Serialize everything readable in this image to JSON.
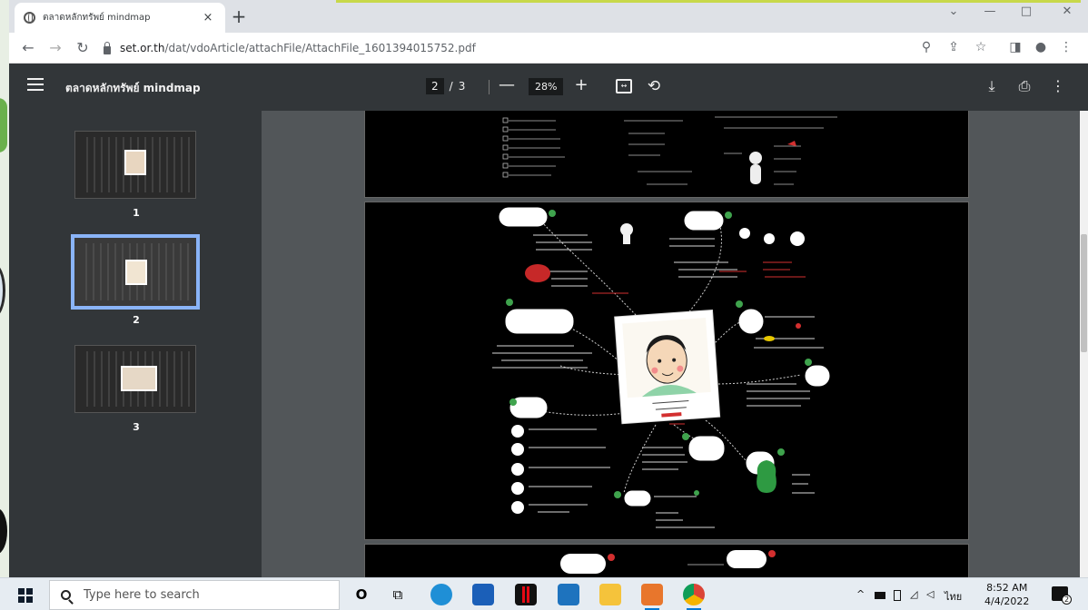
{
  "browser": {
    "tab_title": "ตลาดหลักทรัพย์ mindmap",
    "tab_close": "×",
    "new_tab": "+",
    "win_minimize": "—",
    "win_maximize": "□",
    "win_close": "✕",
    "tab_search": "⌄",
    "url_host": "set.or.th",
    "url_path": "/dat/vdoArticle/attachFile/AttachFile_1601394015752.pdf"
  },
  "pdf": {
    "title": "ตลาดหลักทรัพย์ mindmap",
    "current_page": "2",
    "page_sep": "/",
    "total_pages": "3",
    "zoom_minus": "—",
    "zoom": "28%",
    "zoom_plus": "+",
    "thumbnails": [
      {
        "label": "1"
      },
      {
        "label": "2"
      },
      {
        "label": "3"
      }
    ]
  },
  "taskbar": {
    "search_placeholder": "Type here to search",
    "time": "8:52 AM",
    "date": "4/4/2022",
    "lang": "ไทย"
  },
  "icons": {
    "back": "←",
    "forward": "→",
    "reload": "↻",
    "zoom_icon": "⚲",
    "share": "⇪",
    "star": "☆",
    "sidepanel": "◨",
    "profile": "●",
    "kebab": "⋮",
    "download": "⤓",
    "print": "⎙",
    "more": "⋮",
    "fit": "↔",
    "rotate": "⟲",
    "taskview": "⧉",
    "cortana": "O",
    "tray_up": "^",
    "notif_count": "2"
  },
  "colors": {
    "pdf_toolbar": "#323639",
    "viewer_bg": "#525659",
    "selected_thumb": "#8ab4f8",
    "taskbar_bg": "#e6ecf2",
    "mindmap_accent": "#d32f2f"
  }
}
